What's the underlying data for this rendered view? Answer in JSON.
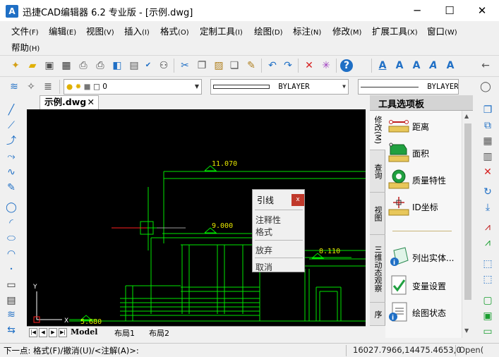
{
  "window": {
    "title": "迅捷CAD编辑器 6.2 专业版  - [示例.dwg]",
    "app_icon_letter": "A",
    "minimize": "─",
    "maximize": "☐",
    "close": "✕"
  },
  "menu": [
    {
      "label": "文件",
      "acc": "(F)"
    },
    {
      "label": "编辑",
      "acc": "(E)"
    },
    {
      "label": "视图",
      "acc": "(V)"
    },
    {
      "label": "插入",
      "acc": "(I)"
    },
    {
      "label": "格式",
      "acc": "(O)"
    },
    {
      "label": "定制工具",
      "acc": "(I)"
    },
    {
      "label": "绘图",
      "acc": "(D)"
    },
    {
      "label": "标注",
      "acc": "(N)"
    },
    {
      "label": "修改",
      "acc": "(M)"
    },
    {
      "label": "扩展工具",
      "acc": "(X)"
    },
    {
      "label": "窗口",
      "acc": "(W)"
    },
    {
      "label": "帮助",
      "acc": "(H)"
    }
  ],
  "properties_bar": {
    "layer_value": "0",
    "linetype_value": "BYLAYER",
    "lineweight_value": "BYLAYER"
  },
  "document_tab": {
    "label": "示例.dwg",
    "close": "✕"
  },
  "drawing": {
    "dim_labels": [
      "11.070",
      "9.000",
      "8.110",
      "5.680"
    ],
    "axis_x": "X",
    "axis_y": "Y"
  },
  "context_menu": {
    "title": "引线",
    "close": "x",
    "items": [
      "注释性",
      "格式",
      "放弃",
      "取消"
    ]
  },
  "layout_tabs": [
    "Model",
    "布局1",
    "布局2"
  ],
  "palette": {
    "title": "工具选项板",
    "side_tabs": [
      "修改(M)",
      "查询",
      "视图",
      "三维动态观察",
      "序"
    ],
    "items": [
      {
        "label": "距离",
        "icon": "distance-icon"
      },
      {
        "label": "面积",
        "icon": "area-icon"
      },
      {
        "label": "质量特性",
        "icon": "mass-properties-icon"
      },
      {
        "label": "ID坐标",
        "icon": "id-point-icon"
      },
      {
        "label": "列出实体...",
        "icon": "list-entities-icon"
      },
      {
        "label": "变量设置",
        "icon": "variable-settings-icon"
      },
      {
        "label": "绘图状态",
        "icon": "drawing-status-icon"
      }
    ]
  },
  "status": {
    "command_prompt": "下一点: 格式(F)/撤消(U)/<注解(A)>:",
    "coordinates": "16027.7966,14475.4653,0",
    "mode": "Open("
  },
  "colors": {
    "canvas_bg": "#000000",
    "drawing_line": "#00e600",
    "crosshair": "#ff2020",
    "close_red": "#c0392b",
    "accent_blue": "#1f6fc5"
  }
}
